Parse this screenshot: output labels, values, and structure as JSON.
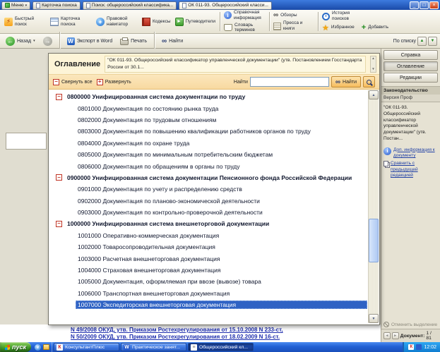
{
  "titlebar": {
    "menu_tab": "Меню",
    "tabs": [
      "Карточка поиска",
      "Поиск: общероссийский классифика...",
      "ОК 011-93. Общероссийский класси..."
    ]
  },
  "toolbar": {
    "quick_search": "Быстрый поиск",
    "search_card": "Карточка поиска",
    "legal_navigator": "Правовой навигатор",
    "codes": "Кодексы",
    "guides": "Путеводители",
    "reference_info": "Справочная информация",
    "term_dictionary": "Словарь терминов",
    "reviews": "Обзоры",
    "press_books": "Пресса и книги",
    "search_history": "История поисков",
    "favorites": "Избранное",
    "add": "Добавить"
  },
  "navbar": {
    "back": "Назад",
    "export_word": "Экспорт в Word",
    "print": "Печать",
    "find": "Найти",
    "by_list": "По списку"
  },
  "dialog": {
    "title": "Оглавление",
    "subtitle": "\"ОК 011-93. Общероссийский классификатор управленческой документации\" (утв. Постановлением Госстандарта России от 30.1...",
    "collapse_all": "Свернуть все",
    "expand": "Развернуть",
    "find_label": "Найти",
    "find_value": "",
    "find_button": "Найти",
    "tree": [
      {
        "code": "0800000",
        "label": "Унифицированная система документации по труду",
        "level": 0
      },
      {
        "code": "0801000",
        "label": "Документация по состоянию рынка труда",
        "level": 1
      },
      {
        "code": "0802000",
        "label": "Документация по трудовым отношениям",
        "level": 1
      },
      {
        "code": "0803000",
        "label": "Документация по повышению квалификации работников органов по труду",
        "level": 1
      },
      {
        "code": "0804000",
        "label": "Документация по охране труда",
        "level": 1
      },
      {
        "code": "0805000",
        "label": "Документация по минимальным потребительским бюджетам",
        "level": 1
      },
      {
        "code": "0806000",
        "label": "Документация по обращениям в органы по труду",
        "level": 1
      },
      {
        "code": "0900000",
        "label": "Унифицированная система документации Пенсионного фонда Российской Федерации",
        "level": 0
      },
      {
        "code": "0901000",
        "label": "Документация по учету и распределению средств",
        "level": 1
      },
      {
        "code": "0902000",
        "label": "Документация по планово-экономической деятельности",
        "level": 1
      },
      {
        "code": "0903000",
        "label": "Документация по контрольно-проверочной деятельности",
        "level": 1
      },
      {
        "code": "1000000",
        "label": "Унифицированная система внешнеторговой документации",
        "level": 0
      },
      {
        "code": "1001000",
        "label": "Оперативно-коммерческая документация",
        "level": 1
      },
      {
        "code": "1002000",
        "label": "Товаросопроводительная документация",
        "level": 1
      },
      {
        "code": "1003000",
        "label": "Расчетная внешнеторговая документация",
        "level": 1
      },
      {
        "code": "1004000",
        "label": "Страховая внешнеторговая документация",
        "level": 1
      },
      {
        "code": "1005000",
        "label": "Документация, оформляемая при ввозе (вывозе) товара",
        "level": 1
      },
      {
        "code": "1006000",
        "label": "Транспортная внешнеторговая документация",
        "level": 1
      },
      {
        "code": "1007000",
        "label": "Экспедиторская внешнеторговая документация",
        "level": 1,
        "selected": true
      }
    ]
  },
  "sidebar": {
    "help": "Справка",
    "toc": "Оглавление",
    "editions": "Редакции",
    "section_title": "Законодательство",
    "section_subtitle": "Версия Проф",
    "doc_ref": "\"ОК 011-93. Общероссийский классификатор управленческой документации\" (утв. Постан...",
    "extra_info": "Доп. информация к документу",
    "compare": "Сравнить с предыдущей редакцией",
    "cancel_selection": "Отменить выделение",
    "doc_label": "Документ:",
    "doc_counter": "1 / 81"
  },
  "document_text": {
    "line1": "N 49/2008 ОКУД, утв. Приказом Ростехрегулирования от 15.10.2008 N 233-ст,",
    "line2": "N 50/2009 ОКУД, утв. Приказом Ростехрегулирования от 18.02.2009 N 16-ст."
  },
  "taskbar": {
    "start": "пуск",
    "buttons": [
      "КонсультантПлюс",
      "Практическое занят...",
      "Общероссийский кл..."
    ],
    "clock": "12:02"
  },
  "icons": {
    "lightning": "⚡",
    "compass": "◈",
    "guide_arrow": "►",
    "info_letter": "i",
    "glasses": "∞",
    "star": "★",
    "plus": "+",
    "minus": "−",
    "back_arrow": "←",
    "forward_arrow": "→",
    "dropdown": "▾",
    "word_letter": "W",
    "binoculars": "∞",
    "up_arrow": "▲",
    "down_arrow": "▼",
    "left_nav": "◄",
    "right_nav": "►",
    "minimize": "_",
    "maximize": "□",
    "close": "×",
    "consultant_letter": "К",
    "ie_letter": "e",
    "page_lines": "≡"
  },
  "colors": {
    "selection_blue": "#2f62c4",
    "dialog_header_bg": "#fdf4d7",
    "controls_band_bg": "#f8d9a0",
    "taskbar_blue": "#2160d4",
    "start_green": "#3f9a27",
    "link_blue": "#1f3fa5",
    "toggle_red": "#c03323"
  }
}
